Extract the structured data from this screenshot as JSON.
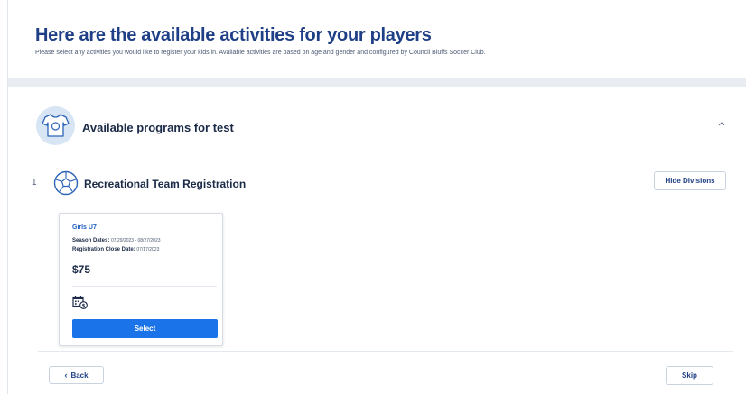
{
  "header": {
    "title": "Here are the available activities for your players",
    "subtitle": "Please select any activities you would like to register your kids in. Available activities are based on age and gender and configured by Council Bluffs Soccer Club."
  },
  "program": {
    "title": "Available programs for test",
    "icon": "jersey-icon",
    "collapse_icon": "chevron-up-icon"
  },
  "activity": {
    "number": "1",
    "icon": "soccer-ball-icon",
    "title": "Recreational Team Registration",
    "hide_divisions_label": "Hide Divisions"
  },
  "division_card": {
    "title": "Girls U7",
    "season_dates_label": "Season Dates:",
    "season_dates_value": "07/29/2023 - 08/27/2023",
    "registration_close_label": "Registration Close Date:",
    "registration_close_value": "07/17/2023",
    "price": "$75",
    "icon": "calendar-dollar-icon",
    "select_label": "Select"
  },
  "footer": {
    "back_label": "Back",
    "back_icon": "chevron-left-icon",
    "skip_label": "Skip"
  },
  "colors": {
    "title": "#1f3f86",
    "accent": "#1a73e8",
    "band": "#e9edf2",
    "icon_bg": "#d7e5f4"
  }
}
